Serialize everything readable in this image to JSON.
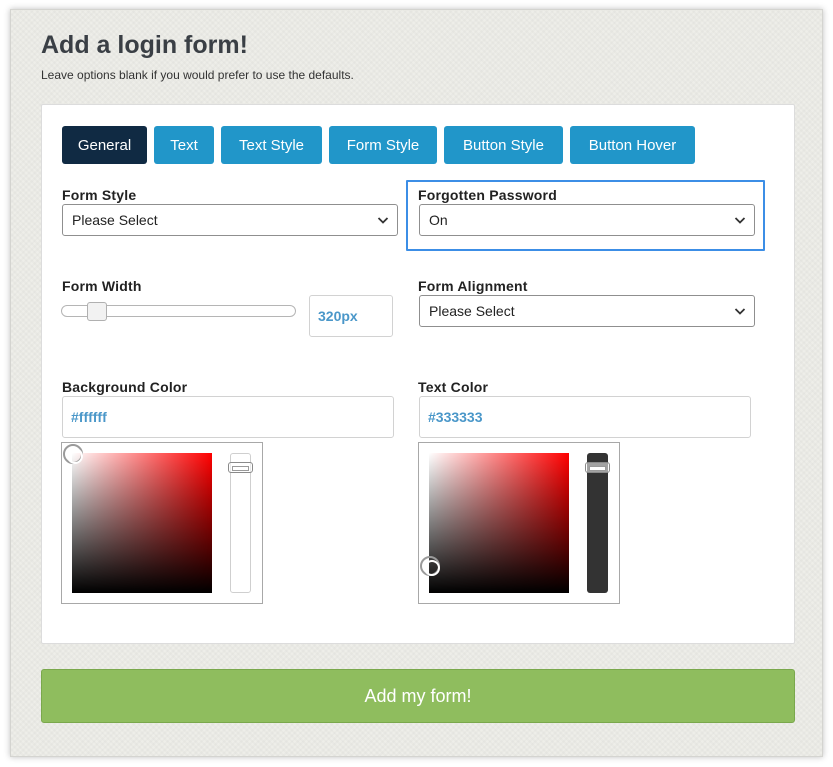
{
  "page": {
    "title": "Add a login form!",
    "subtitle": "Leave options blank if you would prefer to use the defaults."
  },
  "tabs": [
    {
      "label": "General",
      "active": true
    },
    {
      "label": "Text",
      "active": false
    },
    {
      "label": "Text Style",
      "active": false
    },
    {
      "label": "Form Style",
      "active": false
    },
    {
      "label": "Button Style",
      "active": false
    },
    {
      "label": "Button Hover",
      "active": false
    }
  ],
  "fields": {
    "form_style": {
      "label": "Form Style",
      "value": "Please Select"
    },
    "forgotten_password": {
      "label": "Forgotten Password",
      "value": "On"
    },
    "form_width": {
      "label": "Form Width",
      "value": "320px",
      "slider_fraction": 0.12
    },
    "form_alignment": {
      "label": "Form Alignment",
      "value": "Please Select"
    },
    "background_color": {
      "label": "Background Color",
      "value": "#ffffff"
    },
    "text_color": {
      "label": "Text Color",
      "value": "#333333"
    }
  },
  "submit": {
    "label": "Add my form!"
  },
  "colors": {
    "tab": "#2196c9",
    "tab_active": "#102a43",
    "submit": "#8fbd5e",
    "focus": "#3c8ee6",
    "value_text": "#4a97c9"
  },
  "icons": {
    "select_arrow": "chevron-down-icon"
  }
}
